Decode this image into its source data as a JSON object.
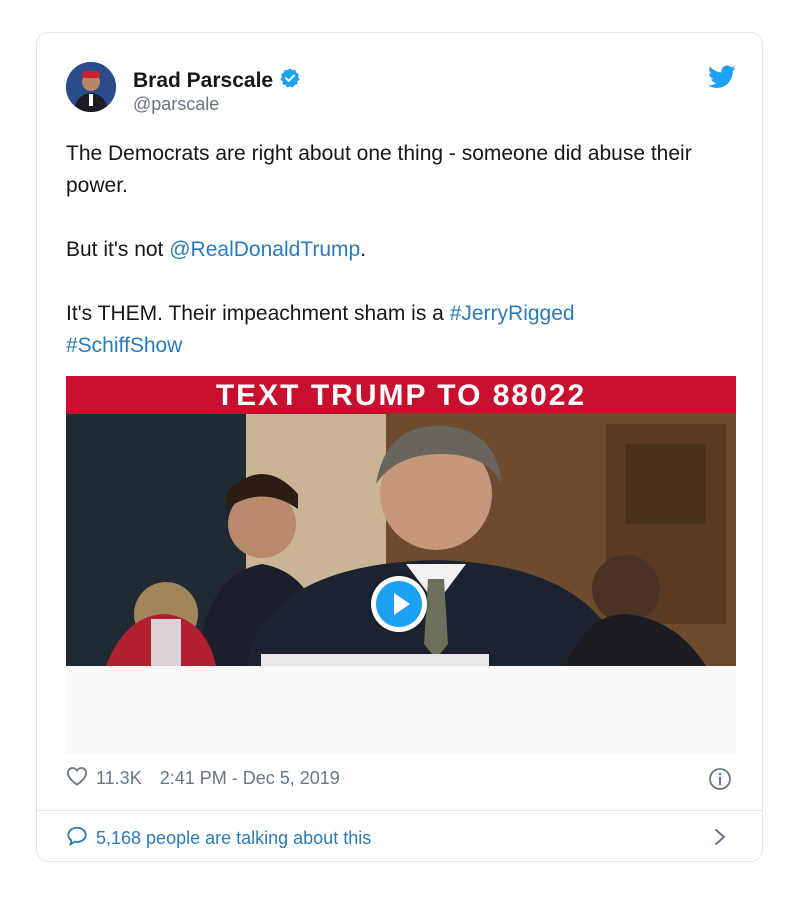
{
  "author": {
    "name": "Brad Parscale",
    "handle": "@parscale",
    "verified": true
  },
  "tweet": {
    "line1": "The Democrats are right about one thing - someone did abuse their power.",
    "line2_prefix": "But it's not ",
    "line2_mention": "@RealDonaldTrump",
    "line2_suffix": ".",
    "line3_text": "It's THEM. Their impeachment sham is a ",
    "hashtag1": "#JerryRigged",
    "hashtag2": "#SchiffShow"
  },
  "media": {
    "banner_text": "TEXT TRUMP TO 88022",
    "banner_color": "#c8102e"
  },
  "meta": {
    "likes": "11.3K",
    "time": "2:41 PM - Dec 5, 2019"
  },
  "talking": "5,168 people are talking about this",
  "colors": {
    "link": "#2b7bb9",
    "twitter_blue": "#1da1f2",
    "muted": "#657786"
  },
  "icons": [
    "twitter-bird-icon",
    "verified-icon",
    "play-icon",
    "heart-icon",
    "info-icon",
    "speech-bubble-icon",
    "chevron-right-icon"
  ]
}
